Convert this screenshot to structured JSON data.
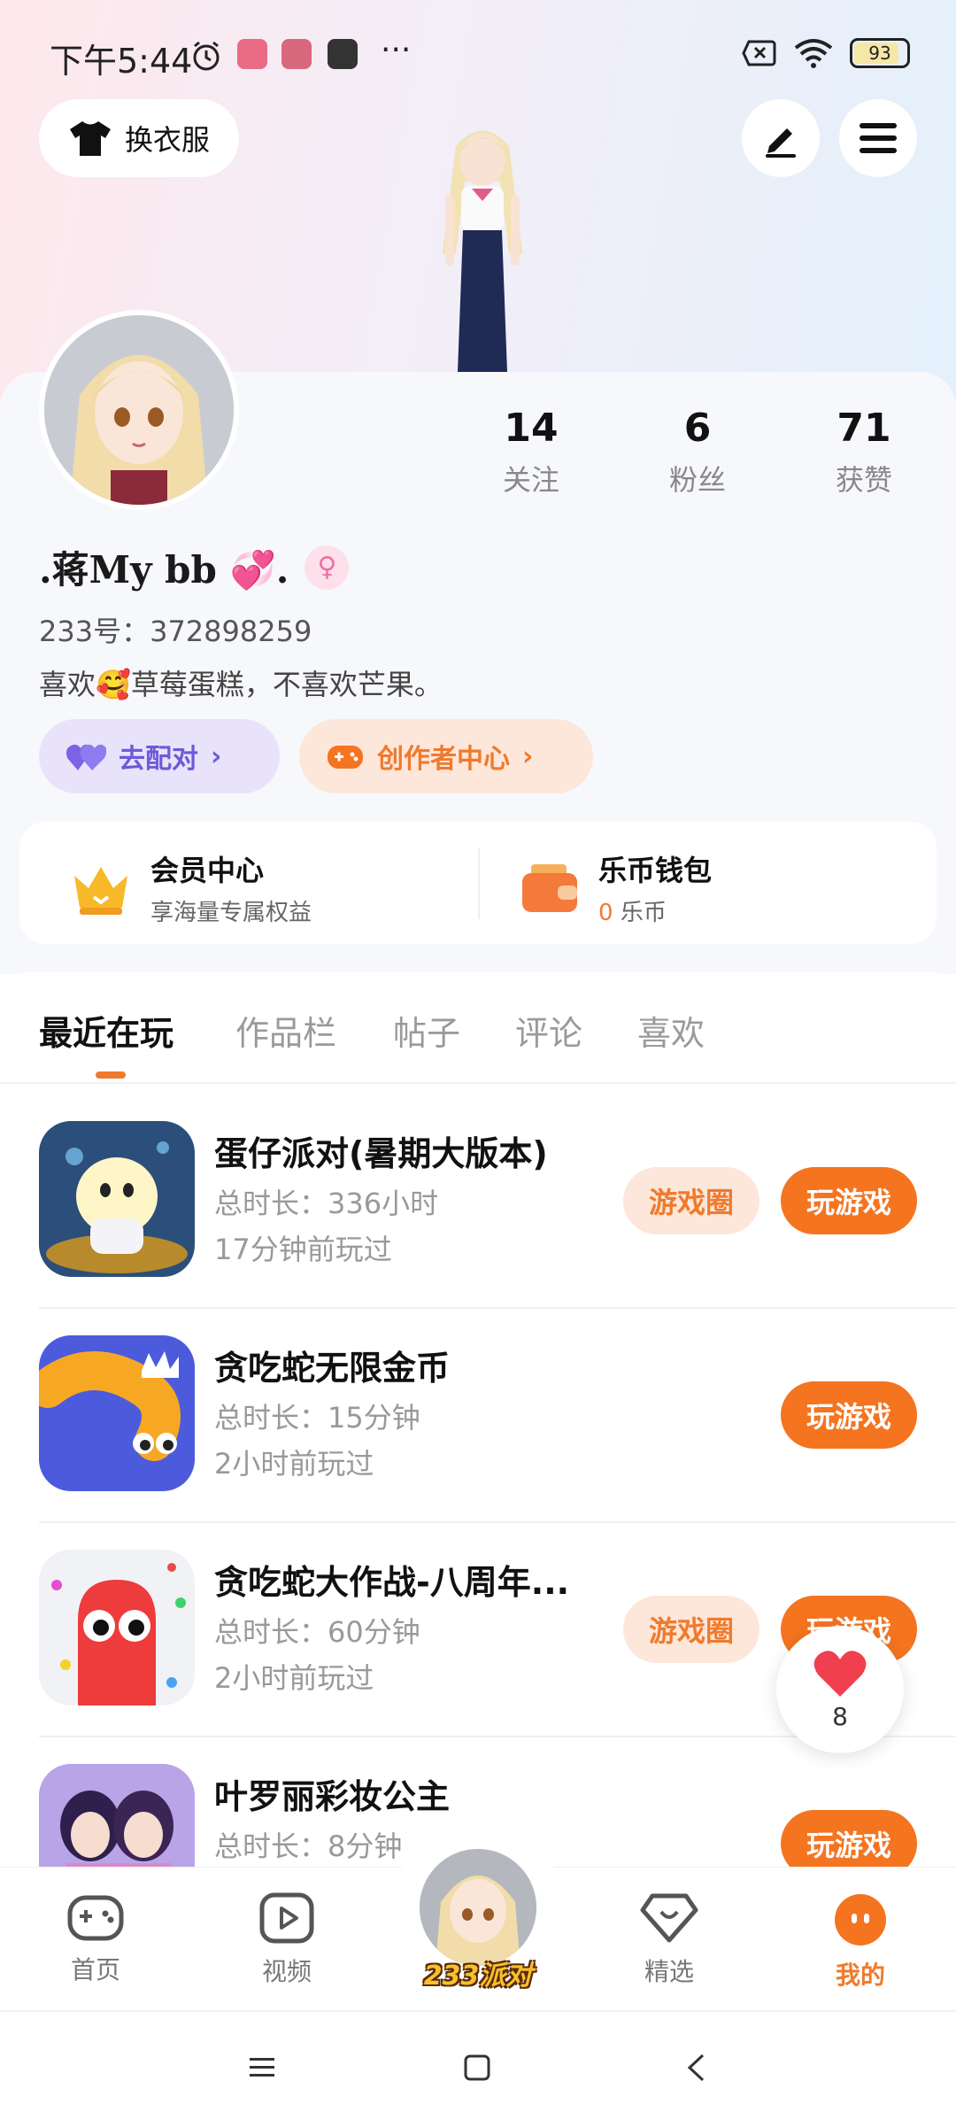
{
  "status_bar": {
    "time": "下午5:44",
    "more": "···",
    "battery": "93"
  },
  "top": {
    "dress_label": "换衣服"
  },
  "profile": {
    "nickname": ".蒋My bb 💞.",
    "uid": "233号：372898259",
    "bio": "喜欢🥰草莓蛋糕，不喜欢芒果。",
    "stats": [
      {
        "num": "14",
        "label": "关注"
      },
      {
        "num": "6",
        "label": "粉丝"
      },
      {
        "num": "71",
        "label": "获赞"
      }
    ],
    "match_label": "去配对",
    "creator_label": "创作者中心"
  },
  "cards": {
    "vip_title": "会员中心",
    "vip_sub": "享海量专属权益",
    "wallet_title": "乐币钱包",
    "wallet_amount": "0",
    "wallet_unit": "乐币"
  },
  "tabs": [
    "最近在玩",
    "作品栏",
    "帖子",
    "评论",
    "喜欢"
  ],
  "games": [
    {
      "name": "蛋仔派对(暑期大版本)",
      "duration": "总时长：336小时",
      "last": "17分钟前玩过",
      "circle": "游戏圈",
      "play": "玩游戏"
    },
    {
      "name": "贪吃蛇无限金币",
      "duration": "总时长：15分钟",
      "last": "2小时前玩过",
      "play": "玩游戏"
    },
    {
      "name": "贪吃蛇大作战-八周年...",
      "duration": "总时长：60分钟",
      "last": "2小时前玩过",
      "circle": "游戏圈",
      "play": "玩游戏"
    },
    {
      "name": "叶罗丽彩妆公主",
      "duration": "总时长：8分钟",
      "play": "玩游戏"
    }
  ],
  "like_count": "8",
  "bottom_nav": {
    "home": "首页",
    "video": "视频",
    "center": "233派对",
    "featured": "精选",
    "mine": "我的"
  },
  "colors": {
    "accent": "#f47420",
    "accent_light": "#fde7da",
    "purple": "#6b5bd6"
  }
}
